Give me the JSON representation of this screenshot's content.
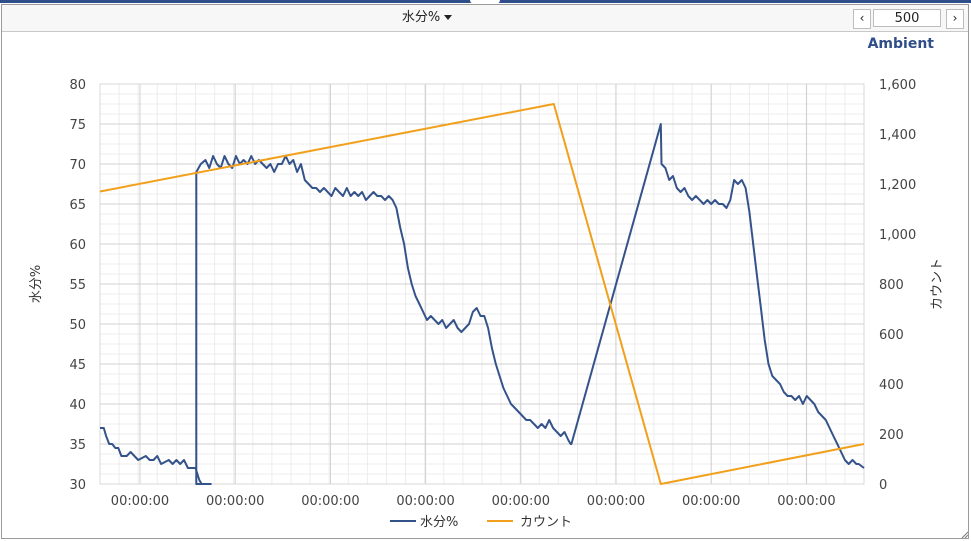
{
  "toolbar": {
    "series_label": "水分%",
    "page_size": "500",
    "prev_glyph": "‹",
    "next_glyph": "›"
  },
  "section_label": "Ambient",
  "colors": {
    "moisture": "#34538a",
    "count": "#f2a01b",
    "grid_major": "#d0d0d0",
    "grid_minor": "#ececec",
    "axis_text": "#444444"
  },
  "chart_data": {
    "type": "line",
    "x_tick_labels": [
      "00:00:00",
      "00:00:00",
      "00:00:00",
      "00:00:00",
      "00:00:00",
      "00:00:00",
      "00:00:00",
      "00:00:00"
    ],
    "y_left": {
      "label": "水分%",
      "min": 30,
      "max": 80,
      "ticks": [
        "30",
        "35",
        "40",
        "45",
        "50",
        "55",
        "60",
        "65",
        "70",
        "75",
        "80"
      ]
    },
    "y_right": {
      "label": "カウント",
      "min": 0,
      "max": 1600,
      "ticks": [
        "0",
        "200",
        "400",
        "600",
        "800",
        "1,000",
        "1,200",
        "1,400",
        "1,600"
      ]
    },
    "x_range": [
      0,
      100
    ],
    "legend": {
      "placement": "bottom",
      "entries": [
        "水分%",
        "カウント"
      ]
    },
    "series": [
      {
        "name": "水分%",
        "axis": "left",
        "points": [
          [
            0,
            37
          ],
          [
            0.5,
            37
          ],
          [
            0.8,
            36
          ],
          [
            1.2,
            35
          ],
          [
            1.6,
            35
          ],
          [
            2.0,
            34.5
          ],
          [
            2.4,
            34.5
          ],
          [
            2.8,
            33.5
          ],
          [
            3.5,
            33.5
          ],
          [
            4.0,
            34
          ],
          [
            4.5,
            33.5
          ],
          [
            5,
            33
          ],
          [
            6,
            33.5
          ],
          [
            6.5,
            33
          ],
          [
            7,
            33
          ],
          [
            7.5,
            33.5
          ],
          [
            8,
            32.5
          ],
          [
            9,
            33
          ],
          [
            9.5,
            32.5
          ],
          [
            10,
            33
          ],
          [
            10.5,
            32.5
          ],
          [
            11,
            33
          ],
          [
            11.5,
            32
          ],
          [
            12,
            32
          ],
          [
            12.5,
            32
          ],
          [
            13,
            30.5
          ],
          [
            13.3,
            30
          ],
          [
            14,
            30
          ],
          [
            14.5,
            30
          ],
          [
            12.6,
            30
          ],
          [
            12.6,
            69
          ],
          [
            13.2,
            70
          ],
          [
            13.8,
            70.5
          ],
          [
            14.3,
            69.5
          ],
          [
            14.8,
            71
          ],
          [
            15.3,
            70
          ],
          [
            15.8,
            69.5
          ],
          [
            16.3,
            71
          ],
          [
            16.8,
            70
          ],
          [
            17.3,
            69.5
          ],
          [
            17.8,
            71
          ],
          [
            18.3,
            70
          ],
          [
            18.8,
            70.5
          ],
          [
            19.3,
            70
          ],
          [
            19.8,
            71
          ],
          [
            20.3,
            70
          ],
          [
            20.8,
            70.5
          ],
          [
            21.3,
            70
          ],
          [
            21.8,
            69.5
          ],
          [
            22.3,
            70
          ],
          [
            22.8,
            69
          ],
          [
            23.3,
            70
          ],
          [
            23.8,
            70
          ],
          [
            24.3,
            71
          ],
          [
            24.8,
            70
          ],
          [
            25.3,
            70.5
          ],
          [
            25.8,
            69
          ],
          [
            26.3,
            70
          ],
          [
            26.8,
            68
          ],
          [
            27.3,
            67.5
          ],
          [
            27.8,
            67
          ],
          [
            28.3,
            67
          ],
          [
            28.8,
            66.5
          ],
          [
            29.3,
            67
          ],
          [
            29.8,
            66.5
          ],
          [
            30.3,
            66
          ],
          [
            30.8,
            67
          ],
          [
            31.3,
            66.5
          ],
          [
            31.8,
            66
          ],
          [
            32.3,
            67
          ],
          [
            32.8,
            66
          ],
          [
            33.3,
            66.5
          ],
          [
            33.8,
            66
          ],
          [
            34.3,
            66.5
          ],
          [
            34.8,
            65.5
          ],
          [
            35.3,
            66
          ],
          [
            35.8,
            66.5
          ],
          [
            36.3,
            66
          ],
          [
            36.8,
            66
          ],
          [
            37.3,
            65.5
          ],
          [
            37.8,
            66
          ],
          [
            38.3,
            65.5
          ],
          [
            38.8,
            64.5
          ],
          [
            39.3,
            62
          ],
          [
            39.8,
            60
          ],
          [
            40.3,
            57
          ],
          [
            40.8,
            55
          ],
          [
            41.3,
            53.5
          ],
          [
            41.8,
            52.5
          ],
          [
            42.3,
            51.5
          ],
          [
            42.8,
            50.5
          ],
          [
            43.3,
            51
          ],
          [
            43.8,
            50.5
          ],
          [
            44.3,
            50
          ],
          [
            44.8,
            50.5
          ],
          [
            45.3,
            49.5
          ],
          [
            45.8,
            50
          ],
          [
            46.3,
            50.5
          ],
          [
            46.8,
            49.5
          ],
          [
            47.3,
            49
          ],
          [
            47.8,
            49.5
          ],
          [
            48.3,
            50
          ],
          [
            48.8,
            51.5
          ],
          [
            49.3,
            52
          ],
          [
            49.8,
            51
          ],
          [
            50.3,
            51
          ],
          [
            50.8,
            49.5
          ],
          [
            51.3,
            47
          ],
          [
            51.8,
            45
          ],
          [
            52.3,
            43.5
          ],
          [
            52.8,
            42
          ],
          [
            53.3,
            41
          ],
          [
            53.8,
            40
          ],
          [
            54.3,
            39.5
          ],
          [
            54.8,
            39
          ],
          [
            55.3,
            38.5
          ],
          [
            55.8,
            38
          ],
          [
            56.3,
            38
          ],
          [
            56.8,
            37.5
          ],
          [
            57.3,
            37
          ],
          [
            57.8,
            37.5
          ],
          [
            58.3,
            37
          ],
          [
            58.8,
            38
          ],
          [
            59.3,
            37
          ],
          [
            59.8,
            36.5
          ],
          [
            60.3,
            36
          ],
          [
            60.8,
            36.5
          ],
          [
            61.3,
            35.5
          ],
          [
            61.6,
            35
          ],
          [
            61.7,
            35
          ],
          [
            73.4,
            75
          ],
          [
            73.5,
            70
          ],
          [
            74,
            69.5
          ],
          [
            74.5,
            68
          ],
          [
            75,
            68.5
          ],
          [
            75.5,
            67
          ],
          [
            76,
            66.5
          ],
          [
            76.5,
            67
          ],
          [
            77,
            66
          ],
          [
            77.5,
            65.5
          ],
          [
            78,
            66
          ],
          [
            78.5,
            65.5
          ],
          [
            79,
            65
          ],
          [
            79.5,
            65.5
          ],
          [
            80,
            65
          ],
          [
            80.5,
            65.5
          ],
          [
            81,
            65
          ],
          [
            81.5,
            65
          ],
          [
            82,
            64.5
          ],
          [
            82.5,
            65.5
          ],
          [
            83,
            68
          ],
          [
            83.5,
            67.5
          ],
          [
            84,
            68
          ],
          [
            84.5,
            67
          ],
          [
            85,
            64
          ],
          [
            85.5,
            60
          ],
          [
            86,
            56
          ],
          [
            86.5,
            52
          ],
          [
            87,
            48
          ],
          [
            87.5,
            45
          ],
          [
            88,
            43.5
          ],
          [
            88.5,
            43
          ],
          [
            89,
            42.5
          ],
          [
            89.5,
            41.5
          ],
          [
            90,
            41
          ],
          [
            90.5,
            41
          ],
          [
            91,
            40.5
          ],
          [
            91.5,
            41
          ],
          [
            92,
            40
          ],
          [
            92.5,
            41
          ],
          [
            93,
            40.5
          ],
          [
            93.5,
            40
          ],
          [
            94,
            39
          ],
          [
            94.5,
            38.5
          ],
          [
            95,
            38
          ],
          [
            95.5,
            37
          ],
          [
            96,
            36
          ],
          [
            96.5,
            35
          ],
          [
            97,
            34
          ],
          [
            97.5,
            33
          ],
          [
            98,
            32.5
          ],
          [
            98.5,
            33
          ],
          [
            99,
            32.5
          ],
          [
            99.3,
            32.5
          ],
          [
            100,
            32
          ]
        ]
      },
      {
        "name": "カウント",
        "axis": "right",
        "points": [
          [
            0,
            1170
          ],
          [
            59.4,
            1520
          ],
          [
            73.4,
            0
          ],
          [
            100,
            160
          ]
        ]
      }
    ]
  }
}
